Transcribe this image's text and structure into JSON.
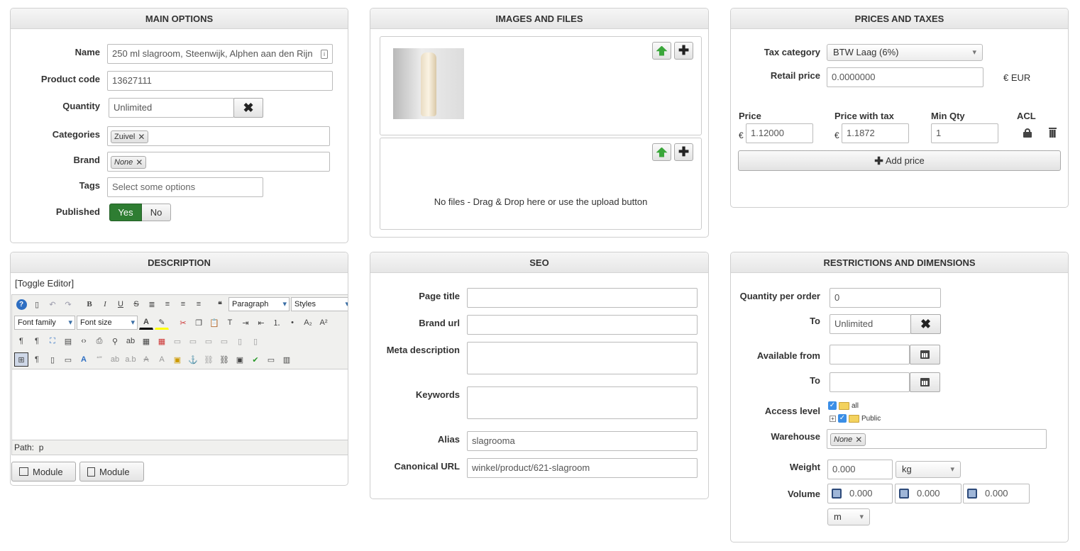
{
  "main_options": {
    "title": "MAIN OPTIONS",
    "name_label": "Name",
    "name_value": "250 ml slagroom,  Steenwijk, Alphen aan den Rijn",
    "product_code_label": "Product code",
    "product_code_value": "13627111",
    "quantity_label": "Quantity",
    "quantity_value": "Unlimited",
    "categories_label": "Categories",
    "category_chip": "Zuivel",
    "brand_label": "Brand",
    "brand_chip": "None",
    "tags_label": "Tags",
    "tags_placeholder": "Select some options",
    "published_label": "Published",
    "yes": "Yes",
    "no": "No"
  },
  "images": {
    "title": "IMAGES AND FILES",
    "no_files": "No files - Drag & Drop here or use the upload button"
  },
  "prices": {
    "title": "PRICES AND TAXES",
    "tax_label": "Tax category",
    "tax_value": "BTW Laag (6%)",
    "retail_label": "Retail price",
    "retail_value": "0.0000000",
    "currency": "€ EUR",
    "col_price": "Price",
    "col_price_tax": "Price with tax",
    "col_min_qty": "Min Qty",
    "col_acl": "ACL",
    "euro": "€",
    "price_value": "1.12000",
    "price_tax_value": "1.1872",
    "min_qty_value": "1",
    "add_price": "Add price"
  },
  "description": {
    "title": "DESCRIPTION",
    "toggle": "[Toggle Editor]",
    "paragraph": "Paragraph",
    "styles": "Styles",
    "font_family": "Font family",
    "font_size": "Font size",
    "path": "Path:  p",
    "module1": "Module",
    "module2": "Module"
  },
  "seo": {
    "title": "SEO",
    "page_title_label": "Page title",
    "brand_url_label": "Brand url",
    "meta_label": "Meta description",
    "keywords_label": "Keywords",
    "alias_label": "Alias",
    "alias_value": "slagrooma",
    "canonical_label": "Canonical URL",
    "canonical_value": "winkel/product/621-slagroom"
  },
  "restrictions": {
    "title": "RESTRICTIONS AND DIMENSIONS",
    "qpo_label": "Quantity per order",
    "qpo_value": "0",
    "to_label": "To",
    "to_value": "Unlimited",
    "available_label": "Available from",
    "to2_label": "To",
    "access_label": "Access level",
    "access_all": "all",
    "access_public": "Public",
    "warehouse_label": "Warehouse",
    "warehouse_chip": "None",
    "weight_label": "Weight",
    "weight_value": "0.000",
    "weight_unit": "kg",
    "volume_label": "Volume",
    "vol1": "0.000",
    "vol2": "0.000",
    "vol3": "0.000",
    "volume_unit": "m"
  },
  "colors": {
    "published_yes": "#2e7d32",
    "upload_green": "#3aa63a",
    "checkbox": "#3b8ee6"
  }
}
